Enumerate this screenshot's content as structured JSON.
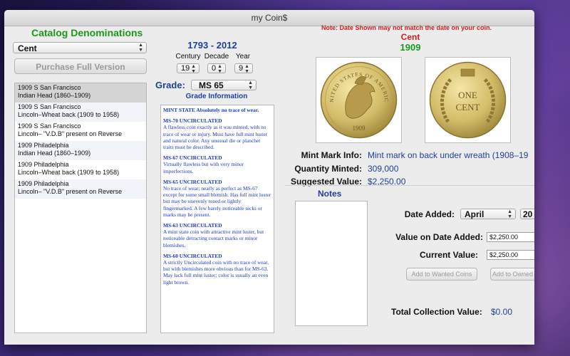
{
  "window": {
    "title": "my Coin$"
  },
  "catalog": {
    "title": "Catalog Denominations",
    "selected": "Cent",
    "purchase_label": "Purchase Full Version",
    "items": [
      {
        "line1": "1909 S San Francisco",
        "line2": "Indian Head (1860–1909)"
      },
      {
        "line1": "1909 S San Francisco",
        "line2": "Lincoln–Wheat back (1909 to 1958)"
      },
      {
        "line1": "1909 S San Francisco",
        "line2": "Lincoln– \"V.D.B\" present on Reverse"
      },
      {
        "line1": "1909   Philadelphia",
        "line2": "Indian Head (1860–1909)"
      },
      {
        "line1": "1909   Philadelphia",
        "line2": "Lincoln–Wheat back (1909 to 1958)"
      },
      {
        "line1": "1909   Philadelphia",
        "line2": "Lincoln– \"V.D.B\" present on Reverse"
      }
    ]
  },
  "years": {
    "range": "1793 - 2012",
    "century_label": "Century",
    "decade_label": "Decade",
    "year_label": "Year",
    "century": "19",
    "decade": "0",
    "year": "9"
  },
  "grade": {
    "label": "Grade:",
    "selected": "MS 65",
    "info_title": "Grade Information",
    "entries": [
      {
        "head": "MINT STATE    Absolutely no trace of wear.",
        "body": ""
      },
      {
        "head": "MS-70              UNCIRCULATED",
        "body": "A flawless coin exactly as it was minted, with no trace of wear or injury.  Must have full mint luster and natural color.  Any unusual die or planchet traits must be described."
      },
      {
        "head": "MS-67              UNCIRCULATED",
        "body": "Virtually flawless but with very minor imperfections."
      },
      {
        "head": "MS-65              UNCIRCULATED",
        "body": "No trace of wear; nearly as perfect as MS-67 except for some small blemish.  Has full mint luster but may be unevenly toned or lightly fingermarked.  A few barely noticeable nicks or marks may be present."
      },
      {
        "head": "MS-63              UNCIRCULATED",
        "body": "A mint state coin with attractive mint luster, but noticeable detracting contact marks or minor blemishes."
      },
      {
        "head": "MS-60              UNCIRCULATED",
        "body": "A strictly Uncirculated coin with no trace of wear, but with blemishes more obvious than for MS-63.  May lack full mint luster; color is usually an even light brown."
      }
    ]
  },
  "coin": {
    "warning": "Note: Date Shown may not match the date on your coin.",
    "denomination": "Cent",
    "year": "1909",
    "obverse_legend": "UNITED STATES OF AMERICA",
    "obverse_date": "1909",
    "reverse_text_1": "ONE",
    "reverse_text_2": "CENT",
    "mint_mark_label": "Mint Mark Info:",
    "mint_mark_value": "Mint mark on back under wreath (1908–19",
    "quantity_label": "Quantity Minted:",
    "quantity_value": "309,000",
    "suggested_label": "Suggested Value:",
    "suggested_value": "$2,250.00"
  },
  "notes": {
    "title": "Notes"
  },
  "collection": {
    "date_added_label": "Date Added:",
    "month": "April",
    "year_partial": "20",
    "value_on_date_label": "Value on Date Added:",
    "value_on_date": "$2,250.00",
    "current_value_label": "Current Value:",
    "current_value": "$2,250.00",
    "add_wanted_label": "Add to Wanted Coins",
    "add_owned_label": "Add to Owned",
    "total_label": "Total Collection Value:",
    "total_value": "$0.00"
  },
  "colors": {
    "green": "#1a9a1a",
    "blue": "#1f3f9f",
    "red": "#e02020"
  }
}
